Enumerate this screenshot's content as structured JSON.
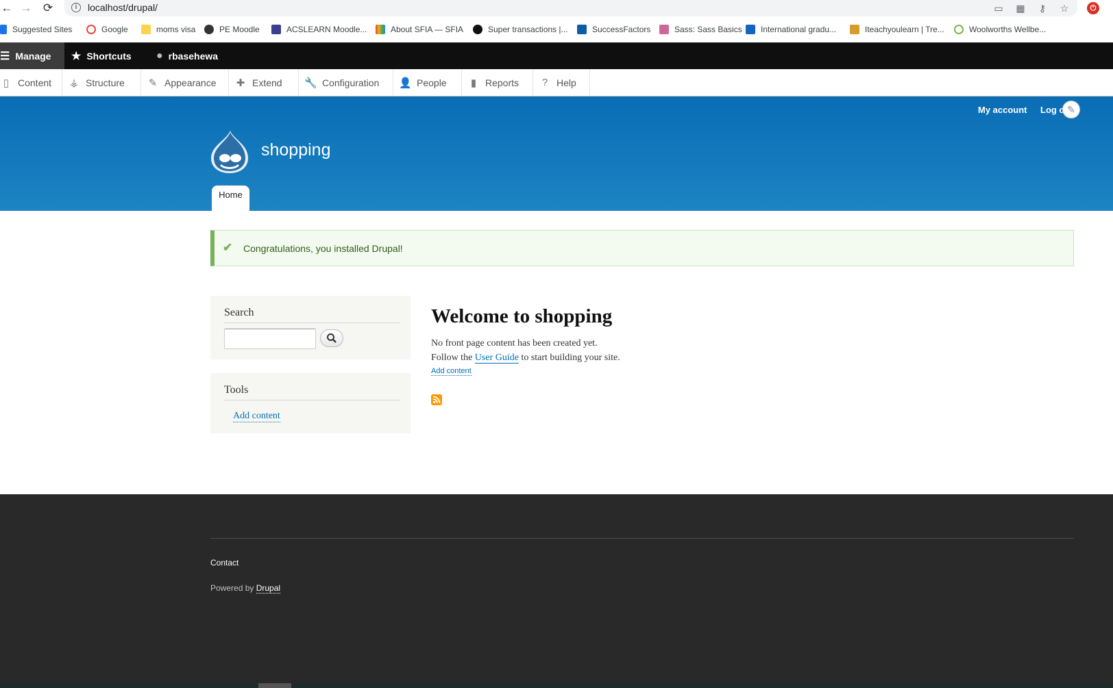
{
  "browser": {
    "url": "localhost/drupal/",
    "bookmarks": [
      {
        "label": "Suggested Sites",
        "color": "#1a73e8"
      },
      {
        "label": "Google",
        "color": "#ea4335"
      },
      {
        "label": "moms visa",
        "color": "#fbd34d"
      },
      {
        "label": "PE Moodle",
        "color": "#333333"
      },
      {
        "label": "ACSLEARN Moodle...",
        "color": "#3b3f8f"
      },
      {
        "label": "About SFIA — SFIA",
        "color": "#e2432b"
      },
      {
        "label": "Super transactions |...",
        "color": "#111111"
      },
      {
        "label": "SuccessFactors",
        "color": "#0a5ea8"
      },
      {
        "label": "Sass: Sass Basics",
        "color": "#cd6799"
      },
      {
        "label": "International gradu...",
        "color": "#1565c0"
      },
      {
        "label": "Iteachyoulearn | Tre...",
        "color": "#d79b2c"
      },
      {
        "label": "Woolworths Wellbe...",
        "color": "#7cb342"
      }
    ]
  },
  "toolbar": {
    "manage": "Manage",
    "shortcuts": "Shortcuts",
    "user": "rbasehewa"
  },
  "tray": {
    "items": [
      {
        "label": "Content",
        "icon": "file-icon"
      },
      {
        "label": "Structure",
        "icon": "sitemap-icon"
      },
      {
        "label": "Appearance",
        "icon": "paintbrush-icon"
      },
      {
        "label": "Extend",
        "icon": "puzzle-icon"
      },
      {
        "label": "Configuration",
        "icon": "wrench-icon"
      },
      {
        "label": "People",
        "icon": "people-icon"
      },
      {
        "label": "Reports",
        "icon": "bar-chart-icon"
      },
      {
        "label": "Help",
        "icon": "help-icon"
      }
    ]
  },
  "header": {
    "my_account": "My account",
    "log_out": "Log o",
    "site_name": "shopping",
    "home_tab": "Home",
    "brand_color": "#0a6db5"
  },
  "message": {
    "text": "Congratulations, you installed Drupal!"
  },
  "sidebar": {
    "search_title": "Search",
    "tools_title": "Tools",
    "tools_link": "Add content"
  },
  "main": {
    "title": "Welcome to shopping",
    "line1": "No front page content has been created yet.",
    "line2_before": "Follow the",
    "line2_link": "User Guide",
    "line2_after": "to start building your site.",
    "add_content": "Add content"
  },
  "footer": {
    "contact": "Contact",
    "powered_by": "Powered by",
    "drupal": "Drupal"
  }
}
